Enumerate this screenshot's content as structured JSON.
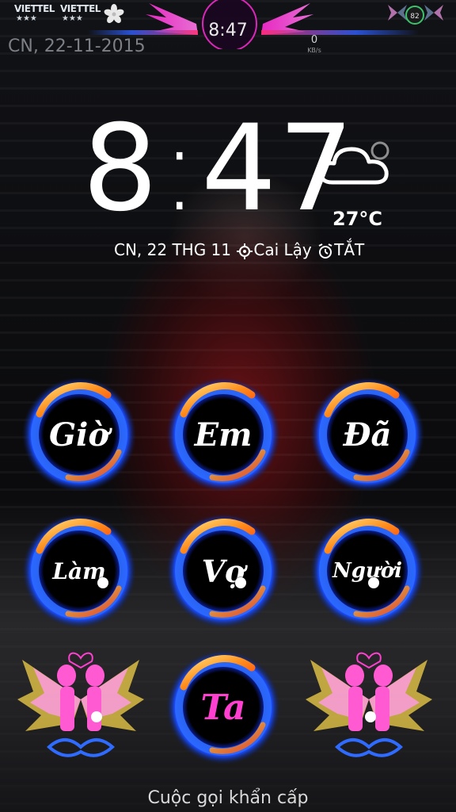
{
  "status_bar": {
    "carrier_1": "VIETTEL",
    "carrier_2": "VIETTEL",
    "carrier_stars": "★★★",
    "clock": "8:47",
    "net_speed_value": "0",
    "net_speed_unit": "KB/s",
    "date": "CN, 22-11-2015",
    "battery_level": "82"
  },
  "lockscreen": {
    "hour": "8",
    "colon": ":",
    "minutes": "47",
    "temperature": "27°C",
    "weather_icon": "cloud-icon",
    "date": "CN, 22 THG 11",
    "location": "Cai Lậy",
    "alarm": "TẮT"
  },
  "apps": [
    {
      "label": "Giờ"
    },
    {
      "label": "Em"
    },
    {
      "label": "Đã"
    },
    {
      "label": "Làm"
    },
    {
      "label": "Vợ"
    },
    {
      "label": "Người"
    },
    {
      "label": "Ta"
    }
  ],
  "footer": {
    "emergency_call": "Cuộc gọi khẩn cấp"
  },
  "colors": {
    "ring_blue": "#1a4cff",
    "ring_fire": "#ff8a1a",
    "ta_pink": "#ff3fd0",
    "angel_pink": "#ff5ad2",
    "angel_wing": "#f4d24a"
  }
}
